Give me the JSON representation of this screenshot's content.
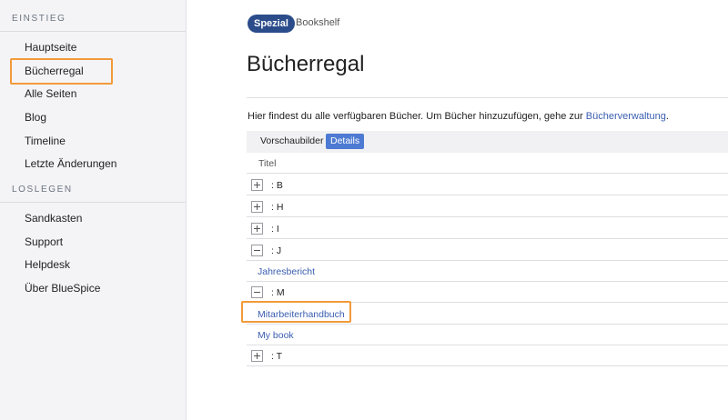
{
  "sidebar": {
    "section1": "EINSTIEG",
    "section2": "LOSLEGEN",
    "items1": [
      "Hauptseite",
      "Bücherregal",
      "Alle Seiten",
      "Blog",
      "Timeline",
      "Letzte Änderungen"
    ],
    "items2": [
      "Sandkasten",
      "Support",
      "Helpdesk",
      "Über BlueSpice"
    ]
  },
  "breadcrumb": {
    "pill": "Spezial",
    "current": "Bookshelf"
  },
  "page": {
    "title": "Bücherregal",
    "intro_text": "Hier findest du alle verfügbaren Bücher. Um Bücher hinzuzufügen, gehe zur ",
    "intro_link": "Bücherverwaltung",
    "intro_end": "."
  },
  "views": {
    "thumbnails": "Vorschaubilder",
    "details": "Details"
  },
  "table": {
    "header": "Titel",
    "rows": [
      {
        "type": "group",
        "label": ": B",
        "expanded": false
      },
      {
        "type": "group",
        "label": ": H",
        "expanded": false
      },
      {
        "type": "group",
        "label": ": I",
        "expanded": false
      },
      {
        "type": "group",
        "label": ": J",
        "expanded": true
      },
      {
        "type": "book",
        "label": "Jahresbericht"
      },
      {
        "type": "group",
        "label": ": M",
        "expanded": true
      },
      {
        "type": "book",
        "label": "Mitarbeiterhandbuch"
      },
      {
        "type": "book",
        "label": "My book"
      },
      {
        "type": "group",
        "label": ": T",
        "expanded": false
      }
    ]
  },
  "colors": {
    "accent": "#2b4c8b",
    "highlight": "#f29a3a",
    "link": "#3a5db0"
  }
}
